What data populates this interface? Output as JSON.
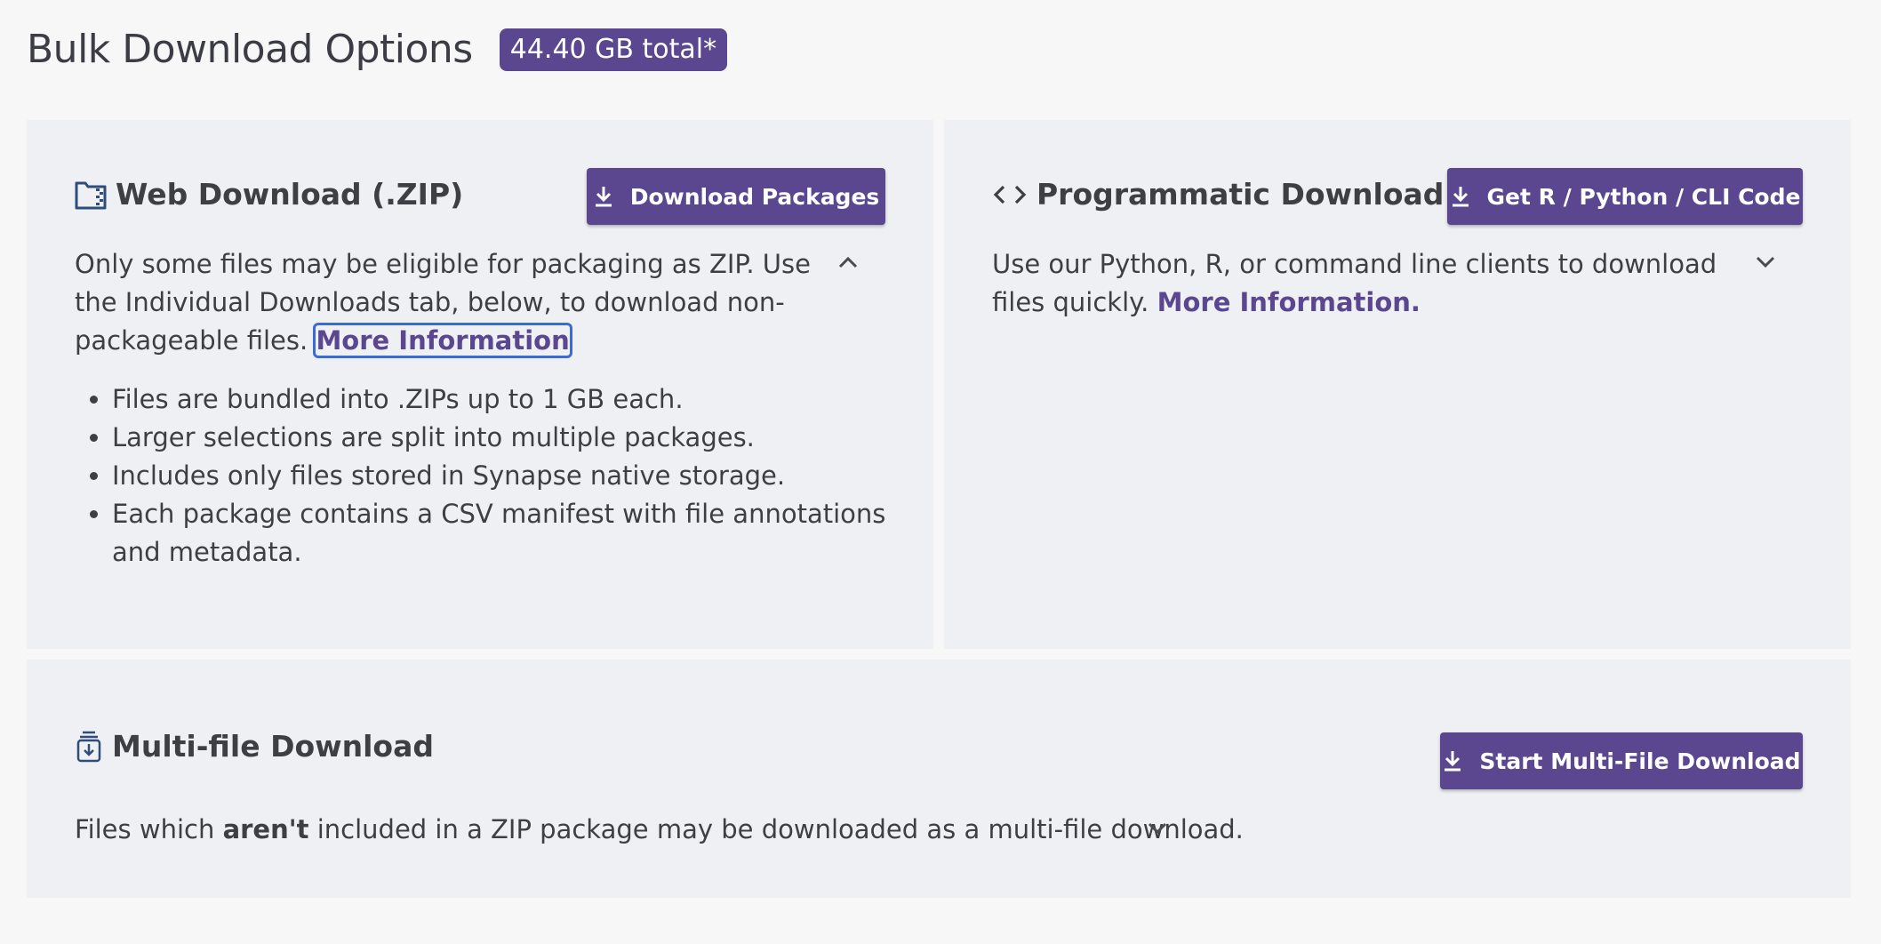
{
  "header": {
    "title": "Bulk Download Options",
    "size_badge": "44.40 GB total*"
  },
  "web_download": {
    "icon": "folder-zip-icon",
    "title": "Web Download (.ZIP)",
    "button_label": "Download Packages",
    "desc_text": "Only some files may be eligible for packaging as ZIP. Use the Individual Downloads tab, below, to download non-packageable files.",
    "more_info_link": "More Information",
    "expanded": true,
    "bullets": [
      "Files are bundled into .ZIPs up to 1 GB each.",
      "Larger selections are split into multiple packages.",
      "Includes only files stored in Synapse native storage.",
      "Each package contains a CSV manifest with file annotations and metadata."
    ]
  },
  "programmatic_download": {
    "icon": "code-icon",
    "title": "Programmatic Download",
    "button_label": "Get R / Python / CLI Code",
    "desc_text": "Use our Python, R, or command line clients to download files quickly.",
    "more_info_link": "More Information.",
    "expanded": false
  },
  "multi_file_download": {
    "icon": "multi-file-download-icon",
    "title": "Multi-file Download",
    "button_label": "Start Multi-File Download",
    "desc_prefix": "Files which",
    "desc_bold": "aren't",
    "desc_suffix": "included in a ZIP package may be downloaded as a multi-file download.",
    "expanded": false
  },
  "colors": {
    "accent": "#5a478f",
    "card_bg": "#eff0f3",
    "page_bg": "#f7f7f7",
    "text": "#3e3f45",
    "focus_ring": "#3b6cd4"
  }
}
